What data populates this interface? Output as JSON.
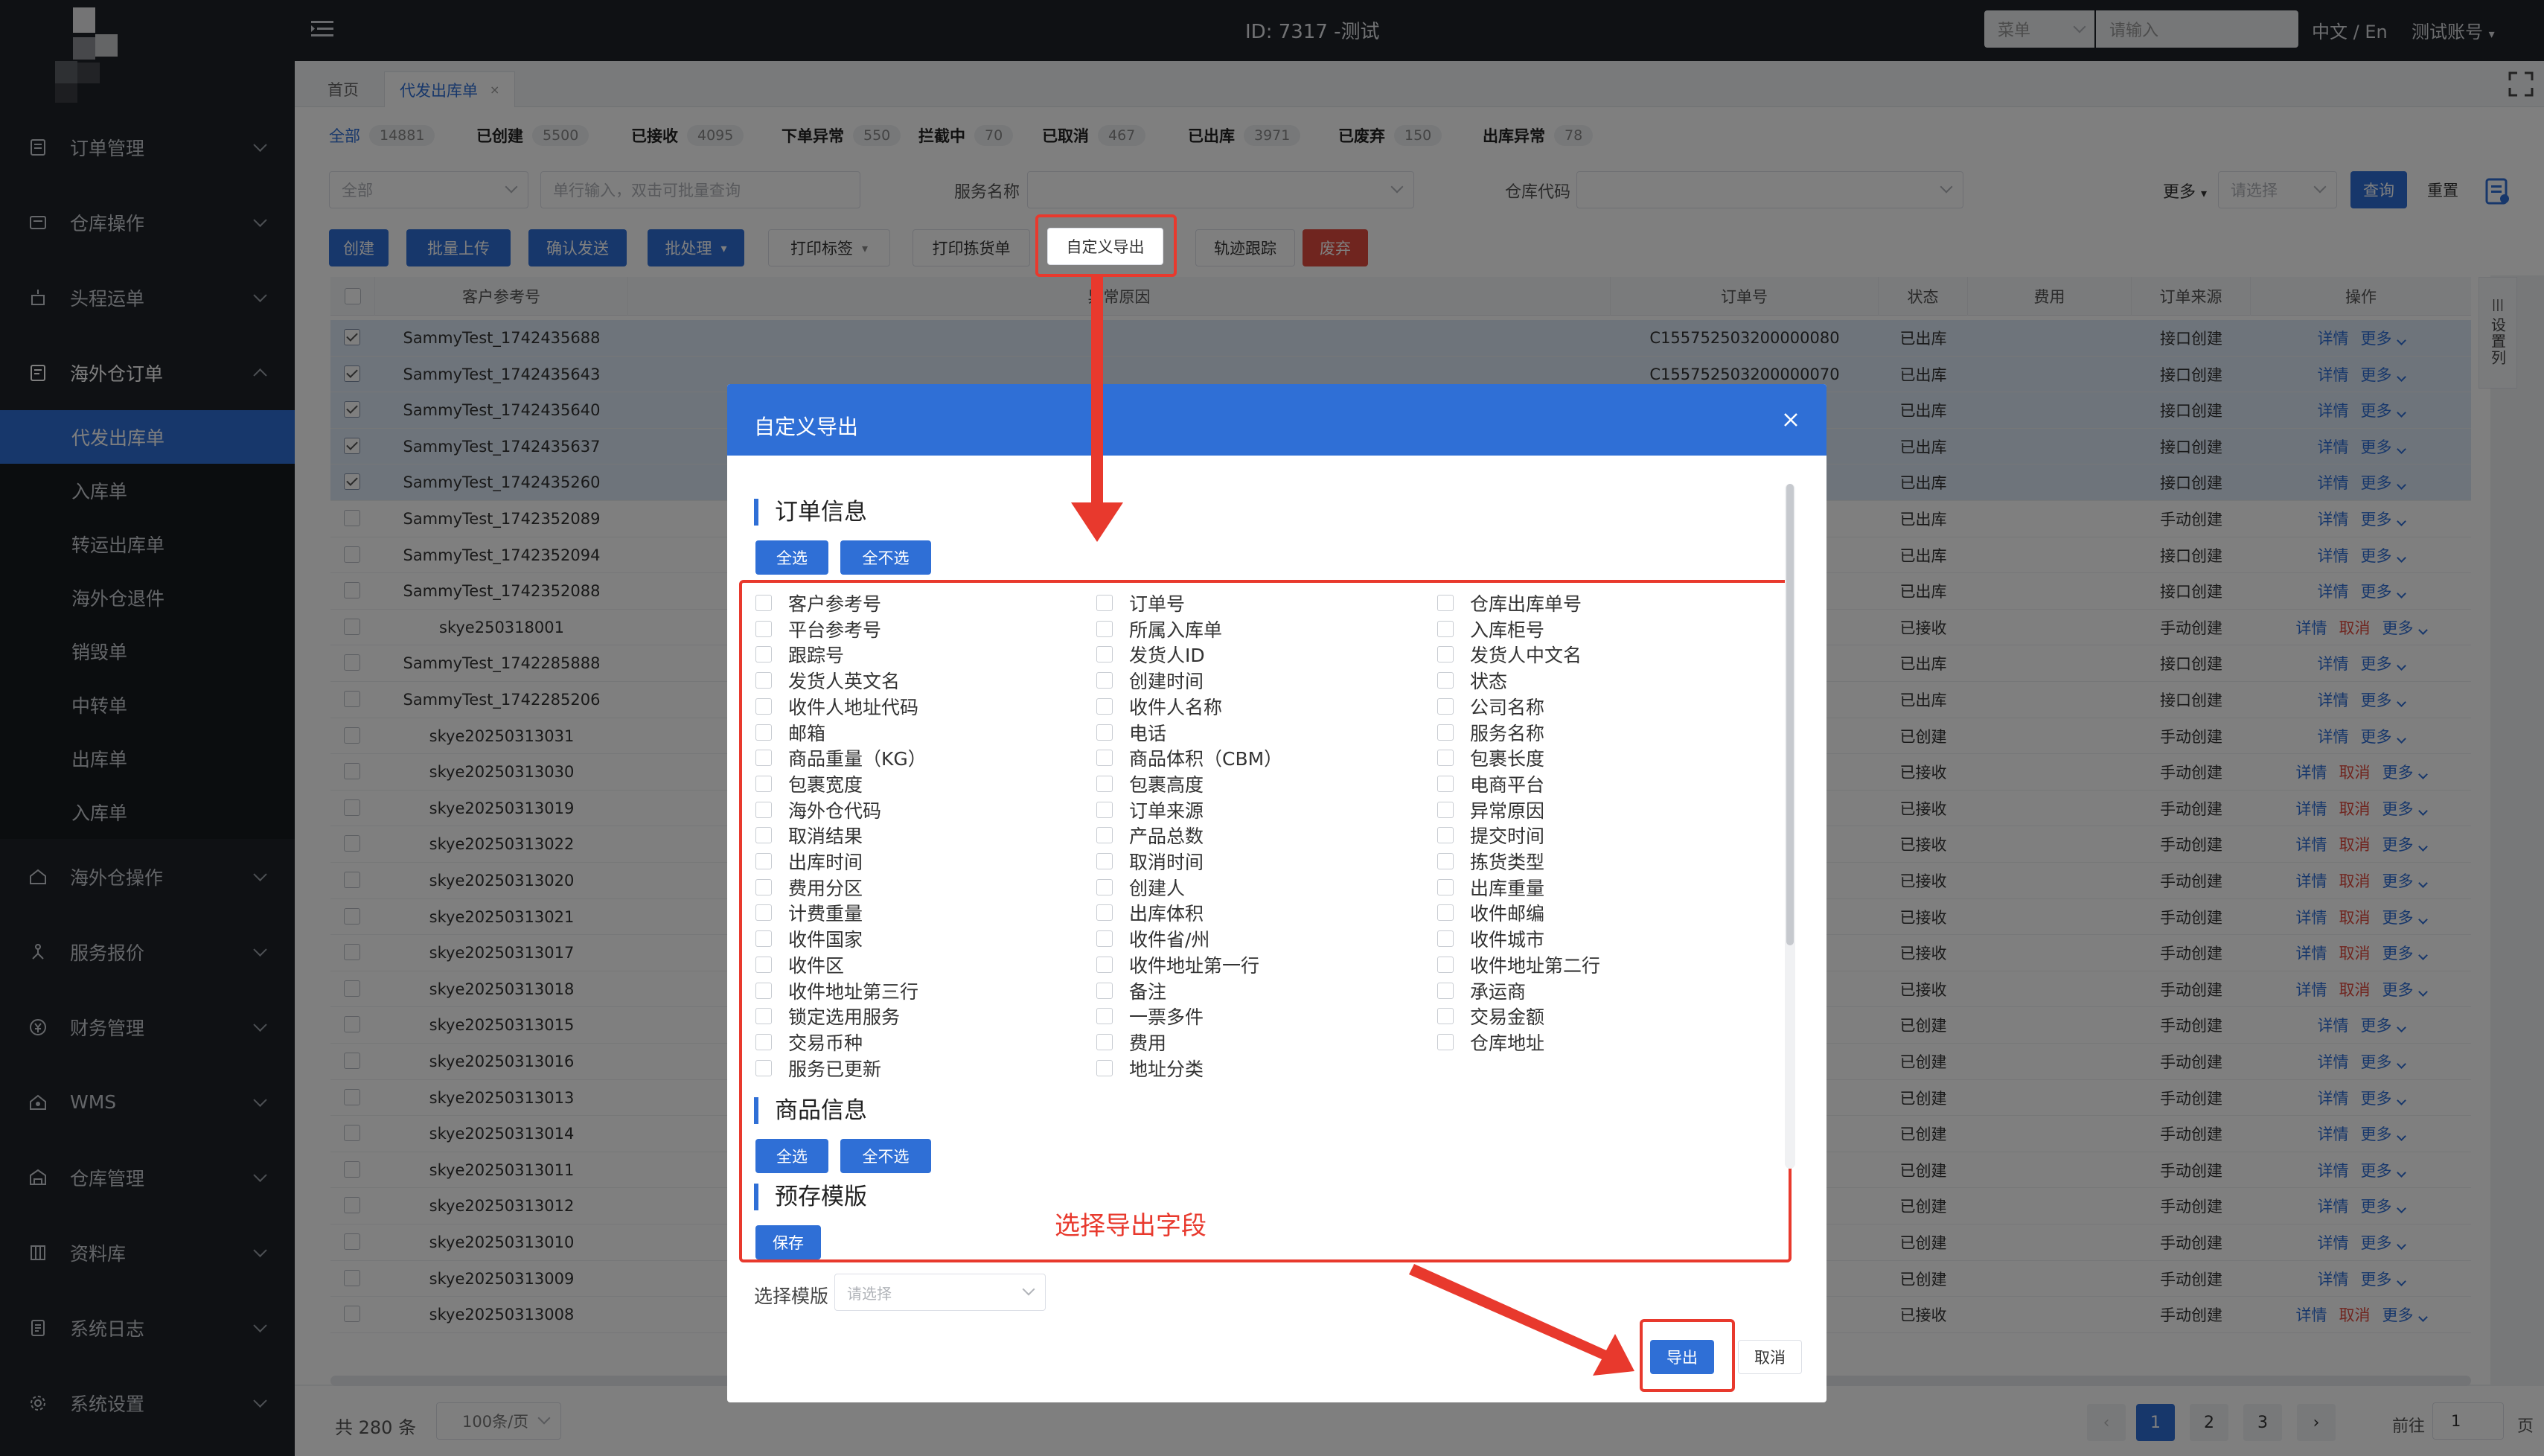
{
  "topbar": {
    "title": "ID: 7317 -测试",
    "search_select": "菜单",
    "search_placeholder": "请输入",
    "lang": "中文 / En",
    "account": "测试账号"
  },
  "sidebar": {
    "groups": [
      {
        "label": "订单管理",
        "icon": "order-icon"
      },
      {
        "label": "仓库操作",
        "icon": "warehouse-op-icon"
      },
      {
        "label": "头程运单",
        "icon": "freight-icon"
      },
      {
        "label": "海外仓订单",
        "icon": "overseas-order-icon",
        "open": true,
        "items": [
          "代发出库单",
          "入库单",
          "转运出库单",
          "海外仓退件",
          "销毁单",
          "中转单",
          "出库单",
          "入库单"
        ]
      },
      {
        "label": "海外仓操作",
        "icon": "overseas-op-icon"
      },
      {
        "label": "服务报价",
        "icon": "quote-icon"
      },
      {
        "label": "财务管理",
        "icon": "finance-icon"
      },
      {
        "label": "WMS",
        "icon": "wms-icon"
      },
      {
        "label": "仓库管理",
        "icon": "warehouse-mgmt-icon"
      },
      {
        "label": "资料库",
        "icon": "library-icon"
      },
      {
        "label": "系统日志",
        "icon": "log-icon"
      },
      {
        "label": "系统设置",
        "icon": "settings-icon"
      }
    ]
  },
  "page_tabs": {
    "home": "首页",
    "current": "代发出库单"
  },
  "status_tabs": [
    {
      "label": "全部",
      "count": "14881"
    },
    {
      "label": "已创建",
      "count": "5500"
    },
    {
      "label": "已接收",
      "count": "4095"
    },
    {
      "label": "下单异常",
      "count": "550"
    },
    {
      "label": "拦截中",
      "count": "70"
    },
    {
      "label": "已取消",
      "count": "467"
    },
    {
      "label": "已出库",
      "count": "3971"
    },
    {
      "label": "已废弃",
      "count": "150"
    },
    {
      "label": "出库异常",
      "count": "78"
    }
  ],
  "filters": {
    "scope": "全部",
    "order_placeholder": "单行输入，双击可批量查询",
    "service_label": "服务名称",
    "warehouse_label": "仓库代码",
    "more": "更多",
    "more_placeholder": "请选择",
    "query": "查询",
    "reset": "重置"
  },
  "actions": {
    "create": "创建",
    "batch_upload": "批量上传",
    "confirm_send": "确认发送",
    "batch_process": "批处理",
    "print_label": "打印标签",
    "print_pick": "打印拣货单",
    "custom_export": "自定义导出",
    "track": "轨迹跟踪",
    "discard": "废弃"
  },
  "table": {
    "headers": {
      "ref": "客户参考号",
      "reason": "异常原因",
      "order_no": "订单号",
      "status": "状态",
      "fee": "费用",
      "source": "订单来源",
      "ops": "操作"
    },
    "set_columns": "设置列",
    "op_detail": "详情",
    "op_cancel": "取消",
    "op_more": "更多",
    "rows": [
      {
        "ref": "SammyTest_1742435688",
        "order": "C155752503200000080",
        "status": "已出库",
        "source": "接口创建",
        "checked": true,
        "cancel": false
      },
      {
        "ref": "SammyTest_1742435643",
        "order": "C155752503200000070",
        "status": "已出库",
        "source": "接口创建",
        "checked": true,
        "cancel": false
      },
      {
        "ref": "SammyTest_1742435640",
        "order": "",
        "status": "已出库",
        "source": "接口创建",
        "checked": true,
        "cancel": false
      },
      {
        "ref": "SammyTest_1742435637",
        "order": "",
        "status": "已出库",
        "source": "接口创建",
        "checked": true,
        "cancel": false
      },
      {
        "ref": "SammyTest_1742435260",
        "order": "",
        "status": "已出库",
        "source": "接口创建",
        "checked": true,
        "cancel": false
      },
      {
        "ref": "SammyTest_1742352089",
        "order": "",
        "status": "已出库",
        "source": "手动创建",
        "checked": false,
        "cancel": false
      },
      {
        "ref": "SammyTest_1742352094",
        "order": "",
        "status": "已出库",
        "source": "接口创建",
        "checked": false,
        "cancel": false
      },
      {
        "ref": "SammyTest_1742352088",
        "order": "",
        "status": "已出库",
        "source": "接口创建",
        "checked": false,
        "cancel": false
      },
      {
        "ref": "skye250318001",
        "order": "",
        "status": "已接收",
        "source": "手动创建",
        "checked": false,
        "cancel": true
      },
      {
        "ref": "SammyTest_1742285888",
        "order": "",
        "status": "已出库",
        "source": "接口创建",
        "checked": false,
        "cancel": false
      },
      {
        "ref": "SammyTest_1742285206",
        "order": "",
        "status": "已出库",
        "source": "接口创建",
        "checked": false,
        "cancel": false
      },
      {
        "ref": "skye20250313031",
        "order": "",
        "status": "已创建",
        "source": "手动创建",
        "checked": false,
        "cancel": false
      },
      {
        "ref": "skye20250313030",
        "order": "",
        "status": "已接收",
        "source": "手动创建",
        "checked": false,
        "cancel": true
      },
      {
        "ref": "skye20250313019",
        "order": "",
        "status": "已接收",
        "source": "手动创建",
        "checked": false,
        "cancel": true
      },
      {
        "ref": "skye20250313022",
        "order": "",
        "status": "已接收",
        "source": "手动创建",
        "checked": false,
        "cancel": true
      },
      {
        "ref": "skye20250313020",
        "order": "",
        "status": "已接收",
        "source": "手动创建",
        "checked": false,
        "cancel": true
      },
      {
        "ref": "skye20250313021",
        "order": "",
        "status": "已接收",
        "source": "手动创建",
        "checked": false,
        "cancel": true
      },
      {
        "ref": "skye20250313017",
        "order": "",
        "status": "已接收",
        "source": "手动创建",
        "checked": false,
        "cancel": true
      },
      {
        "ref": "skye20250313018",
        "order": "",
        "status": "已接收",
        "source": "手动创建",
        "checked": false,
        "cancel": true
      },
      {
        "ref": "skye20250313015",
        "order": "",
        "status": "已创建",
        "source": "手动创建",
        "checked": false,
        "cancel": false
      },
      {
        "ref": "skye20250313016",
        "order": "",
        "status": "已创建",
        "source": "手动创建",
        "checked": false,
        "cancel": false
      },
      {
        "ref": "skye20250313013",
        "order": "",
        "status": "已创建",
        "source": "手动创建",
        "checked": false,
        "cancel": false
      },
      {
        "ref": "skye20250313014",
        "order": "",
        "status": "已创建",
        "source": "手动创建",
        "checked": false,
        "cancel": false
      },
      {
        "ref": "skye20250313011",
        "order": "",
        "status": "已创建",
        "source": "手动创建",
        "checked": false,
        "cancel": false
      },
      {
        "ref": "skye20250313012",
        "order": "",
        "status": "已创建",
        "source": "手动创建",
        "checked": false,
        "cancel": false
      },
      {
        "ref": "skye20250313010",
        "order": "",
        "status": "已创建",
        "source": "手动创建",
        "checked": false,
        "cancel": false
      },
      {
        "ref": "skye20250313009",
        "order": "",
        "status": "已创建",
        "source": "手动创建",
        "checked": false,
        "cancel": false
      },
      {
        "ref": "skye20250313008",
        "order": "",
        "status": "已接收",
        "source": "手动创建",
        "checked": false,
        "cancel": true
      }
    ]
  },
  "footer": {
    "total": "共 280 条",
    "page_size": "100条/页",
    "pages": [
      "1",
      "2",
      "3"
    ],
    "goto_label": "前往",
    "goto_value": "1",
    "page_suffix": "页"
  },
  "modal": {
    "title": "自定义导出",
    "sections": {
      "order": "订单信息",
      "product": "商品信息",
      "template": "预存模版"
    },
    "select_all": "全选",
    "select_none": "全不选",
    "save": "保存",
    "fields": [
      [
        "客户参考号",
        "平台参考号",
        "跟踪号",
        "发货人英文名",
        "收件人地址代码",
        "邮箱",
        "商品重量（KG）",
        "包裹宽度",
        "海外仓代码",
        "取消结果",
        "出库时间",
        "费用分区",
        "计费重量",
        "收件国家",
        "收件区",
        "收件地址第三行",
        "锁定选用服务",
        "交易币种",
        "服务已更新"
      ],
      [
        "订单号",
        "所属入库单",
        "发货人ID",
        "创建时间",
        "收件人名称",
        "电话",
        "商品体积（CBM）",
        "包裹高度",
        "订单来源",
        "产品总数",
        "取消时间",
        "创建人",
        "出库体积",
        "收件省/州",
        "收件地址第一行",
        "备注",
        "一票多件",
        "费用",
        "地址分类"
      ],
      [
        "仓库出库单号",
        "入库柜号",
        "发货人中文名",
        "状态",
        "公司名称",
        "服务名称",
        "包裹长度",
        "电商平台",
        "异常原因",
        "提交时间",
        "拣货类型",
        "出库重量",
        "收件邮编",
        "收件城市",
        "收件地址第二行",
        "承运商",
        "交易金额",
        "仓库地址"
      ]
    ],
    "template_label": "选择模版",
    "template_placeholder": "请选择",
    "export": "导出",
    "cancel": "取消"
  },
  "annotation": "选择导出字段",
  "colors": {
    "accent": "#2f6fd6",
    "sidebar": "#1f2328",
    "danger": "#e14a3e",
    "annotation": "#e8392d"
  }
}
